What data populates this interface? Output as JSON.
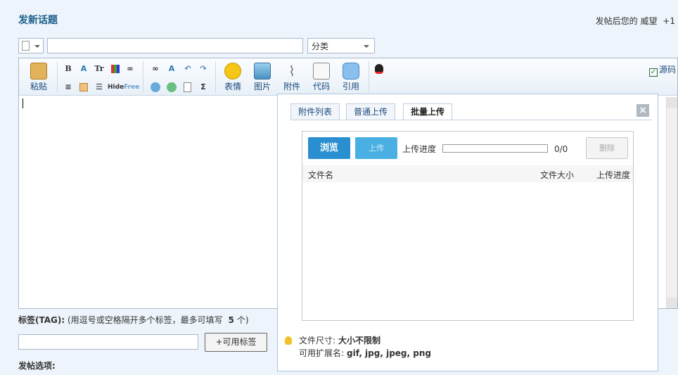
{
  "header": {
    "title": "发新话题",
    "reputation_label": "发帖后您的 威望",
    "reputation_value": "+1"
  },
  "form": {
    "category_value": "分类"
  },
  "toolbar": {
    "paste": "粘贴",
    "small": {
      "bold": "B",
      "text_size": "Tr",
      "hide": "Hide",
      "free": "Free"
    },
    "emoji": "表情",
    "image": "图片",
    "attachment": "附件",
    "code": "代码",
    "quote": "引用",
    "source_mode": "源码",
    "source_check": "✓"
  },
  "upload_panel": {
    "tabs": [
      "附件列表",
      "普通上传",
      "批量上传"
    ],
    "close": "×",
    "browse": "浏览",
    "upload": "上传",
    "progress_label": "上传进度",
    "progress_count": "0/0",
    "delete": "删除",
    "columns": {
      "filename": "文件名",
      "filesize": "文件大小",
      "progress": "上传进度"
    },
    "file_size_label": "文件尺寸:",
    "file_size_value": "大小不限制",
    "ext_label": "可用扩展名:",
    "ext_value": "gif, jpg, jpeg, png"
  },
  "tags": {
    "label": "标签(TAG):",
    "hint": "(用逗号或空格隔开多个标签，最多可填写",
    "max": "5",
    "unit": "个)",
    "button": "+可用标签"
  },
  "post_options": {
    "label": "发帖选项:"
  }
}
